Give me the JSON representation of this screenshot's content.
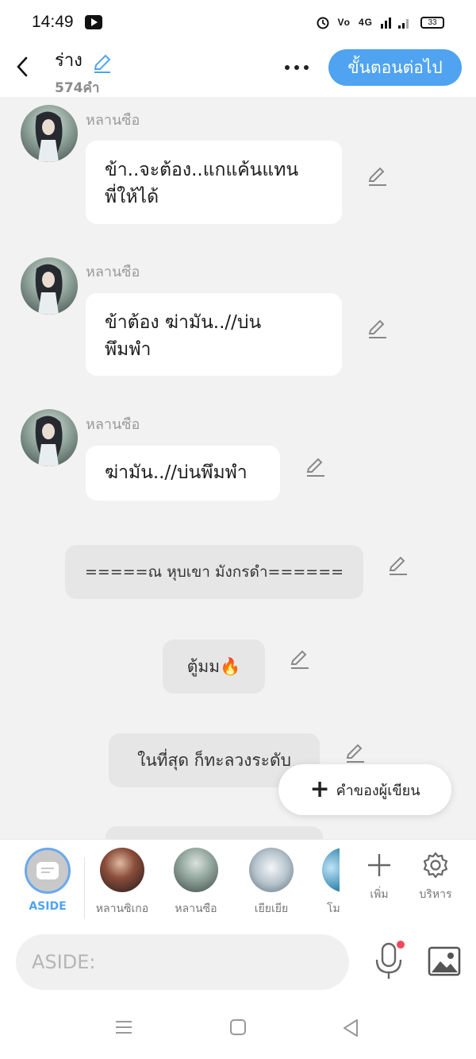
{
  "status": {
    "time": "14:49",
    "network": "4G",
    "battery": "33"
  },
  "header": {
    "title": "ร่าง",
    "word_count": "574คำ",
    "next_label": "ขั้นตอนต่อไป"
  },
  "messages": [
    {
      "type": "character",
      "speaker": "หลานซือ",
      "text_line1": "ข้า..จะต้อง..แกแค้นแทน",
      "text_line2": "พี่ให้ได้"
    },
    {
      "type": "character",
      "speaker": "หลานซือ",
      "text_line1": "ข้าต้อง ฆ่ามัน..//บ่น",
      "text_line2": "พึมพำ"
    },
    {
      "type": "character",
      "speaker": "หลานซือ",
      "text_line1": "ฆ่ามัน..//บ่นพึมพำ"
    },
    {
      "type": "narration",
      "text": "=====ณ  หุบเขา มังกรดำ======"
    },
    {
      "type": "narration",
      "text": "ตู้มม🔥"
    },
    {
      "type": "narration",
      "text": "ในที่สุด ก็ทะลวงระดับ"
    }
  ],
  "fab": {
    "label": "คำของผู้เขียน"
  },
  "characters": [
    {
      "name": "ASIDE"
    },
    {
      "name": "หลานซิเกอ"
    },
    {
      "name": "หลานซือ"
    },
    {
      "name": "เยียเยีย"
    },
    {
      "name": "โม"
    }
  ],
  "tools": {
    "add_label": "เพิ่ม",
    "manage_label": "บริหาร"
  },
  "input": {
    "placeholder": "ASIDE:"
  },
  "colors": {
    "accent": "#4fa3f0",
    "background": "#f2f2f2",
    "bubble": "#ffffff",
    "narration": "#e6e6e6"
  }
}
